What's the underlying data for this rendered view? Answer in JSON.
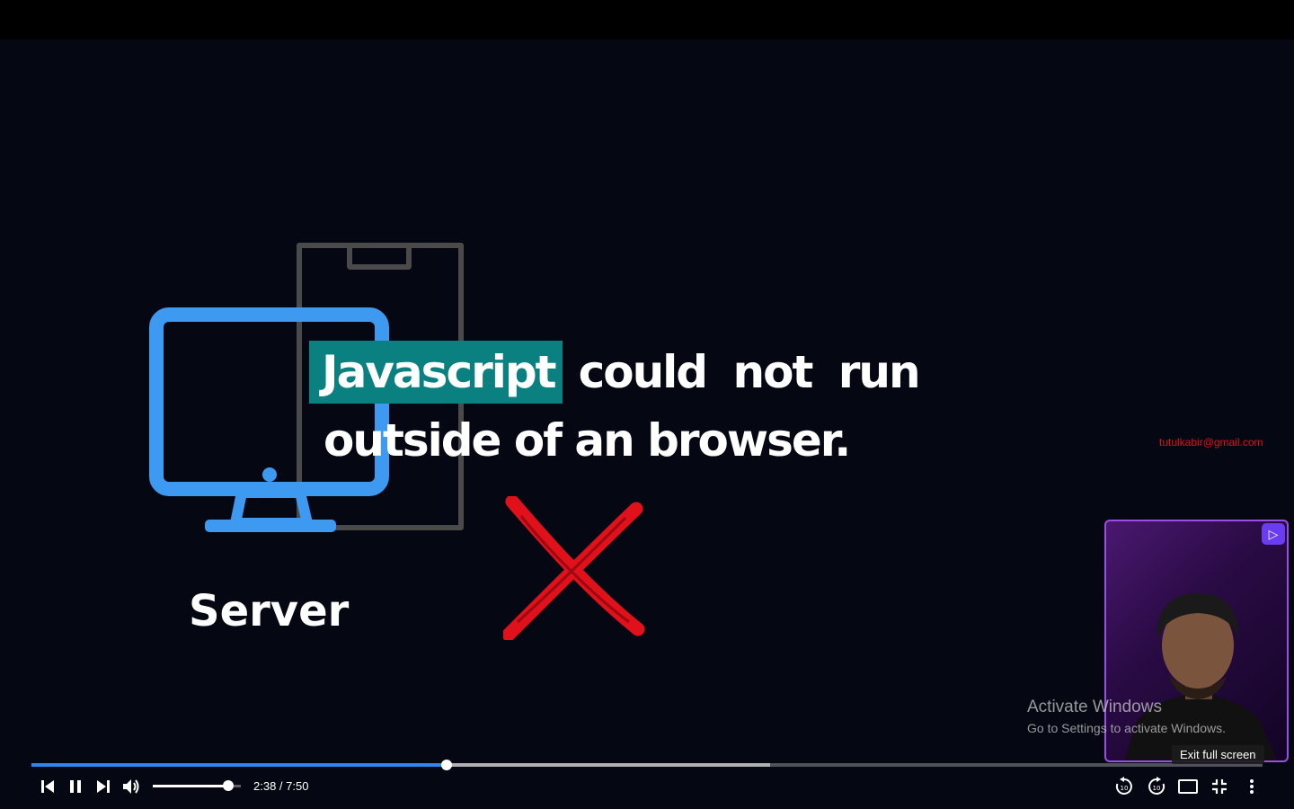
{
  "video": {
    "headline_highlight": "Javascript",
    "headline_rest": "could not run",
    "headline_line2": "outside of an browser.",
    "server_label": "Server",
    "email_watermark": "tutulkabir@gmail.com",
    "highlight_color": "#0b8080",
    "monitor_color": "#3d9af0",
    "cross_color": "#e0111b"
  },
  "watermark": {
    "line1": "Activate Windows",
    "line2": "Go to Settings to activate Windows."
  },
  "player": {
    "current_time": "2:38",
    "duration": "7:50",
    "time_display": "2:38 / 7:50",
    "played_fraction": 0.337,
    "buffered_fraction": 0.6,
    "volume_fraction": 0.86,
    "tooltip": "Exit full screen",
    "accent_color": "#2f86ea",
    "controls": {
      "previous": "skip-previous-icon",
      "pause": "pause-icon",
      "next": "skip-next-icon",
      "volume": "volume-icon",
      "rewind": "rewind-10-icon",
      "forward": "forward-10-icon",
      "theater": "theater-mode-icon",
      "exit_fullscreen": "exit-fullscreen-icon",
      "more": "more-vert-icon"
    }
  }
}
